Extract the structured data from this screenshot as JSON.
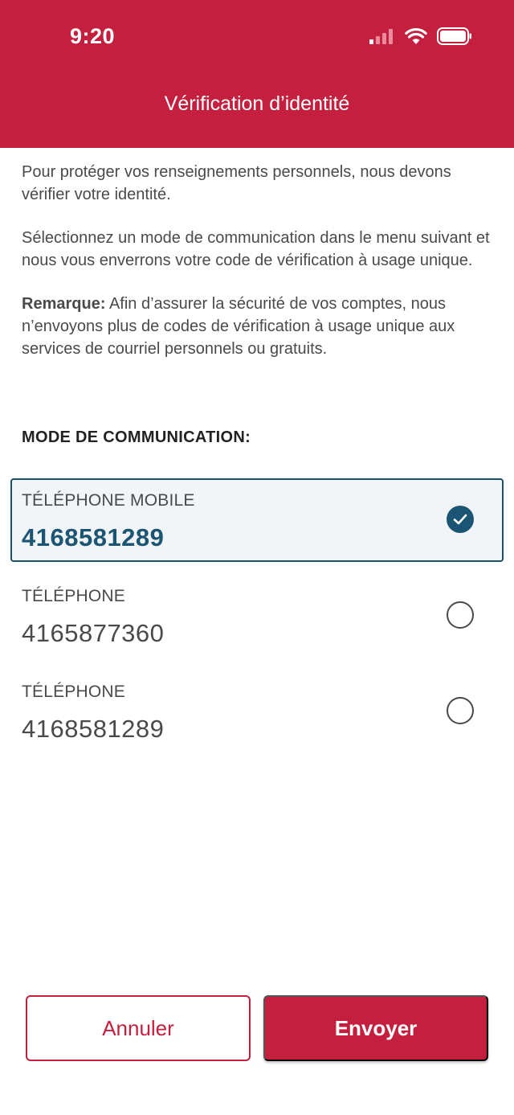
{
  "status_bar": {
    "time": "9:20"
  },
  "header": {
    "title": "Vérification d’identité",
    "background_color": "#c41f3e"
  },
  "intro": {
    "paragraph1": "Pour protéger vos renseignements personnels, nous devons vérifier votre identité.",
    "paragraph2": "Sélectionnez un mode de communication dans le menu suivant et nous vous enverrons votre code de vérification à usage unique.",
    "note_label": "Remarque:",
    "note_text": " Afin d’assurer la sécurité de vos comptes, nous n’envoyons plus de codes de vérification à usage unique aux services de courriel personnels ou gratuits."
  },
  "communication": {
    "label": "MODE DE COMMUNICATION:",
    "selected_index": 0,
    "options": [
      {
        "type": "TÉLÉPHONE MOBILE",
        "number": "4168581289"
      },
      {
        "type": "TÉLÉPHONE",
        "number": "4165877360"
      },
      {
        "type": "TÉLÉPHONE",
        "number": "4168581289"
      }
    ]
  },
  "actions": {
    "cancel_label": "Annuler",
    "send_label": "Envoyer"
  },
  "colors": {
    "brand_red": "#c41f3e",
    "selected_blue": "#1b5573"
  }
}
